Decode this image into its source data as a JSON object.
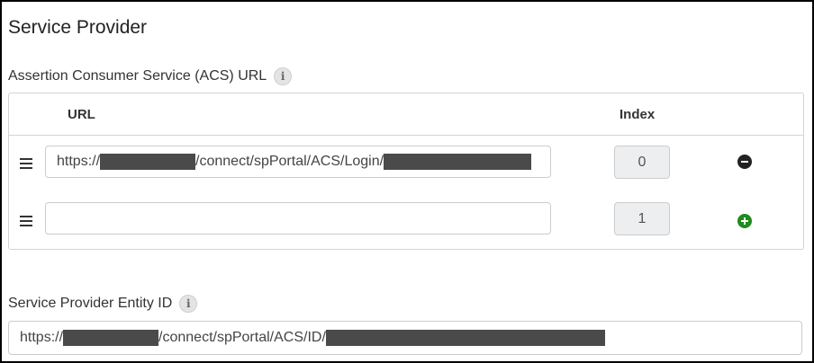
{
  "section": {
    "title": "Service Provider"
  },
  "acs": {
    "label": "Assertion Consumer Service (ACS) URL",
    "info_glyph": "i",
    "columns": {
      "url": "URL",
      "index": "Index"
    },
    "rows": [
      {
        "url_prefix": "https://",
        "url_middle": "/connect/spPortal/ACS/Login/",
        "index": "0",
        "action": "remove"
      },
      {
        "url_prefix": "",
        "url_middle": "",
        "index": "1",
        "action": "add"
      }
    ]
  },
  "entity": {
    "label": "Service Provider Entity ID",
    "info_glyph": "i",
    "value_prefix": "https://",
    "value_middle": "/connect/spPortal/ACS/ID/"
  },
  "colors": {
    "add": "#1e8c1e",
    "remove": "#222222",
    "redaction": "#4a4a4a"
  },
  "icons": [
    "info-icon",
    "drag-handle-icon",
    "minus-circle-icon",
    "plus-circle-icon"
  ]
}
